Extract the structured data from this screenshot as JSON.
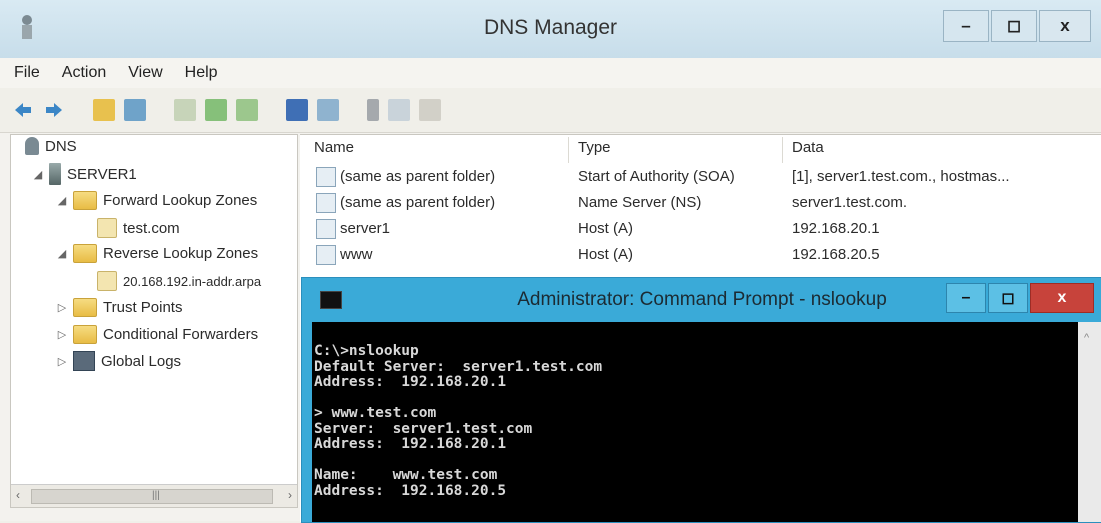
{
  "dns_manager": {
    "title": "DNS Manager",
    "window_buttons": {
      "minimize": "–",
      "maximize": "◻",
      "close": "x"
    },
    "menu": [
      "File",
      "Action",
      "View",
      "Help"
    ],
    "tree": {
      "root": "DNS",
      "server": "SERVER1",
      "forward_zones": "Forward Lookup Zones",
      "forward_zone_item": "test.com",
      "reverse_zones": "Reverse Lookup Zones",
      "reverse_zone_item": "20.168.192.in-addr.arpa",
      "trust_points": "Trust Points",
      "conditional_forwarders": "Conditional Forwarders",
      "global_logs": "Global Logs"
    },
    "list": {
      "columns": [
        "Name",
        "Type",
        "Data"
      ],
      "rows": [
        [
          "(same as parent folder)",
          "Start of Authority (SOA)",
          "[1], server1.test.com., hostmas..."
        ],
        [
          "(same as parent folder)",
          "Name Server (NS)",
          "server1.test.com."
        ],
        [
          "server1",
          "Host (A)",
          "192.168.20.1"
        ],
        [
          "www",
          "Host (A)",
          "192.168.20.5"
        ]
      ]
    }
  },
  "cmd": {
    "title": "Administrator: Command Prompt - nslookup",
    "buttons": {
      "minimize": "–",
      "maximize": "◻",
      "close": "x"
    },
    "output": "C:\\>nslookup\nDefault Server:  server1.test.com\nAddress:  192.168.20.1\n\n> www.test.com\nServer:  server1.test.com\nAddress:  192.168.20.1\n\nName:    www.test.com\nAddress:  192.168.20.5"
  },
  "colors": {
    "cmd_frame": "#3aaad8",
    "cmd_close": "#c7433b",
    "title_bar": "#cfe3ee"
  }
}
